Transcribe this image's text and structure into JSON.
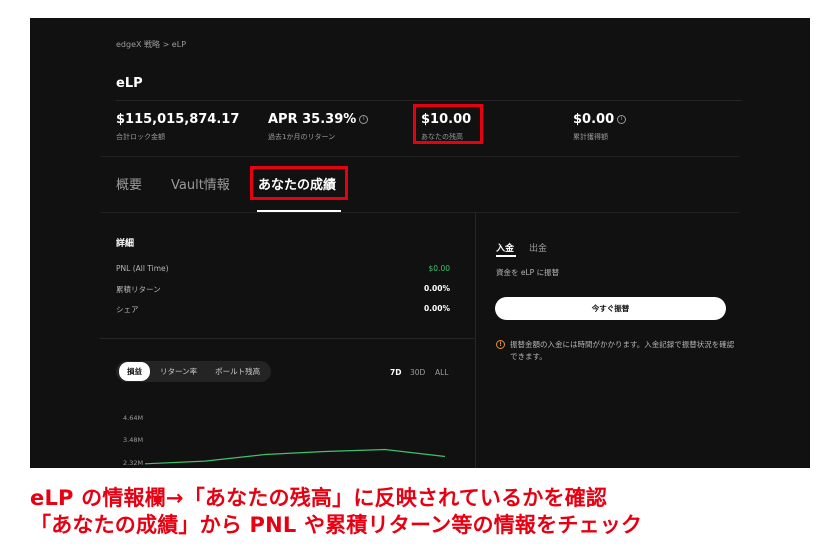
{
  "breadcrumb": "edgeX 戦略 > eLP",
  "page_title": "eLP",
  "stats": [
    {
      "value": "$115,015,874.17",
      "label": "合計ロック金額"
    },
    {
      "value": "APR 35.39%",
      "label": "過去1か月のリターン"
    },
    {
      "value": "$10.00",
      "label": "あなたの残高"
    },
    {
      "value": "$0.00",
      "label": "累計獲得額"
    }
  ],
  "info_icon_glyph": "i",
  "tabs": [
    "概要",
    "Vault情報",
    "あなたの成績"
  ],
  "details": {
    "title": "詳細",
    "rows": [
      {
        "label": "PNL (All Time)",
        "value": "$0.00"
      },
      {
        "label": "累積リターン",
        "value": "0.00%"
      },
      {
        "label": "シェア",
        "value": "0.00%"
      }
    ]
  },
  "chart_toggle": [
    "損益",
    "リターン率",
    "ポールト残高"
  ],
  "ranges": [
    "7D",
    "30D",
    "ALL"
  ],
  "chart_data": {
    "type": "line",
    "yticks": [
      "4.64M",
      "3.48M",
      "2.32M"
    ],
    "x": [
      0,
      1,
      2,
      3,
      4,
      5
    ],
    "values": [
      2.32,
      2.46,
      2.8,
      2.96,
      3.06,
      2.7
    ],
    "ylim": [
      2.1,
      4.7
    ],
    "series_color": "#3ec26a"
  },
  "side_panel": {
    "tabs": [
      "入金",
      "出金"
    ],
    "description": "資金を eLP に振替",
    "button": "今すぐ振替",
    "warning_glyph": "!",
    "warning": "振替金額の入金には時間がかかります。入金記録で振替状況を確認できます。"
  },
  "captions": [
    "eLP の情報欄→「あなたの残高」に反映されているかを確認",
    "「あなたの成績」から PNL や累積リターン等の情報をチェック"
  ],
  "colors": {
    "highlight": "#e60012",
    "positive": "#3ec26a",
    "warning": "#e8902e"
  }
}
